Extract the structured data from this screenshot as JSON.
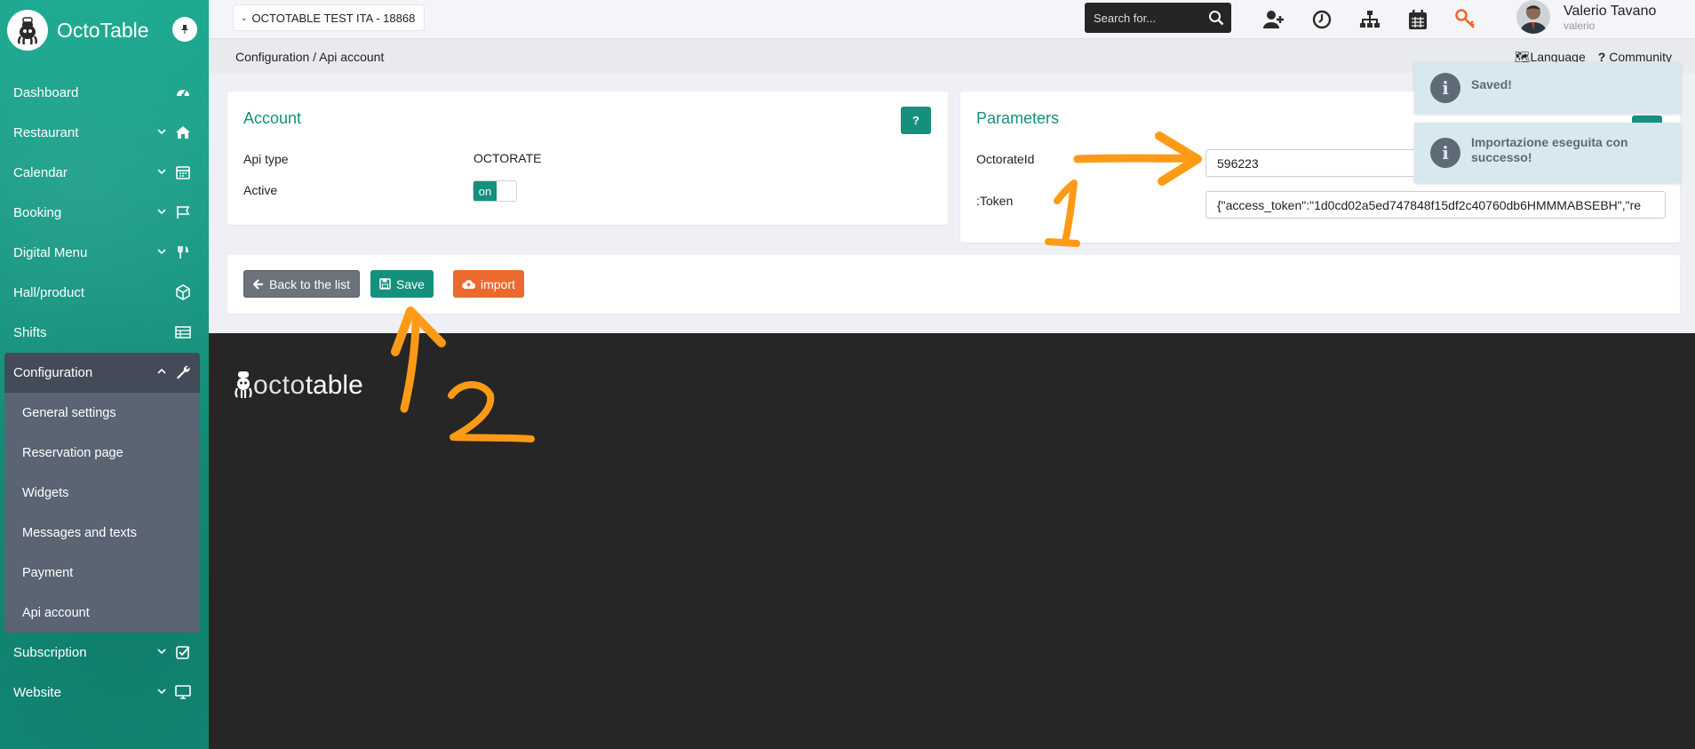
{
  "app": {
    "name": "OctoTable"
  },
  "sidebar": {
    "items": [
      {
        "label": "Dashboard"
      },
      {
        "label": "Restaurant"
      },
      {
        "label": "Calendar"
      },
      {
        "label": "Booking"
      },
      {
        "label": "Digital Menu"
      },
      {
        "label": "Hall/product"
      },
      {
        "label": "Shifts"
      }
    ],
    "config": {
      "label": "Configuration",
      "sub": [
        {
          "label": "General settings"
        },
        {
          "label": "Reservation page"
        },
        {
          "label": "Widgets"
        },
        {
          "label": "Messages and texts"
        },
        {
          "label": "Payment"
        },
        {
          "label": "Api account"
        }
      ]
    },
    "after": [
      {
        "label": "Subscription"
      },
      {
        "label": "Website"
      }
    ]
  },
  "topbar": {
    "restaurant": "OCTOTABLE TEST ITA - 18868",
    "search_placeholder": "Search for...",
    "user_name": "Valerio Tavano",
    "user_login": "valerio"
  },
  "breadcrumb": {
    "path": "Configuration / Api account",
    "language": "Language",
    "community": "Community"
  },
  "account": {
    "title": "Account",
    "help": "?",
    "api_type_label": "Api type",
    "api_type_value": "OCTORATE",
    "active_label": "Active",
    "active_toggle": "on"
  },
  "parameters": {
    "title": "Parameters",
    "help": "?",
    "octorate_label": "OctorateId",
    "octorate_value": "596223",
    "token_label": ":Token",
    "token_value": "{\"access_token\":\"1d0cd02a5ed747848f15df2c40760db6HMMMABSEBH\",\"re"
  },
  "actions": {
    "back": "Back to the list",
    "save": "Save",
    "import": "import"
  },
  "footer": {
    "logo_octo": "octo",
    "logo_table": "table"
  },
  "toasts": [
    {
      "text": "Saved!"
    },
    {
      "text": "Importazione eseguita con successo!"
    }
  ],
  "annotations": {
    "one": "1",
    "two": "2"
  },
  "colors": {
    "brand": "#14907d",
    "import": "#ec6a2f",
    "annotation": "#ff9a17"
  }
}
